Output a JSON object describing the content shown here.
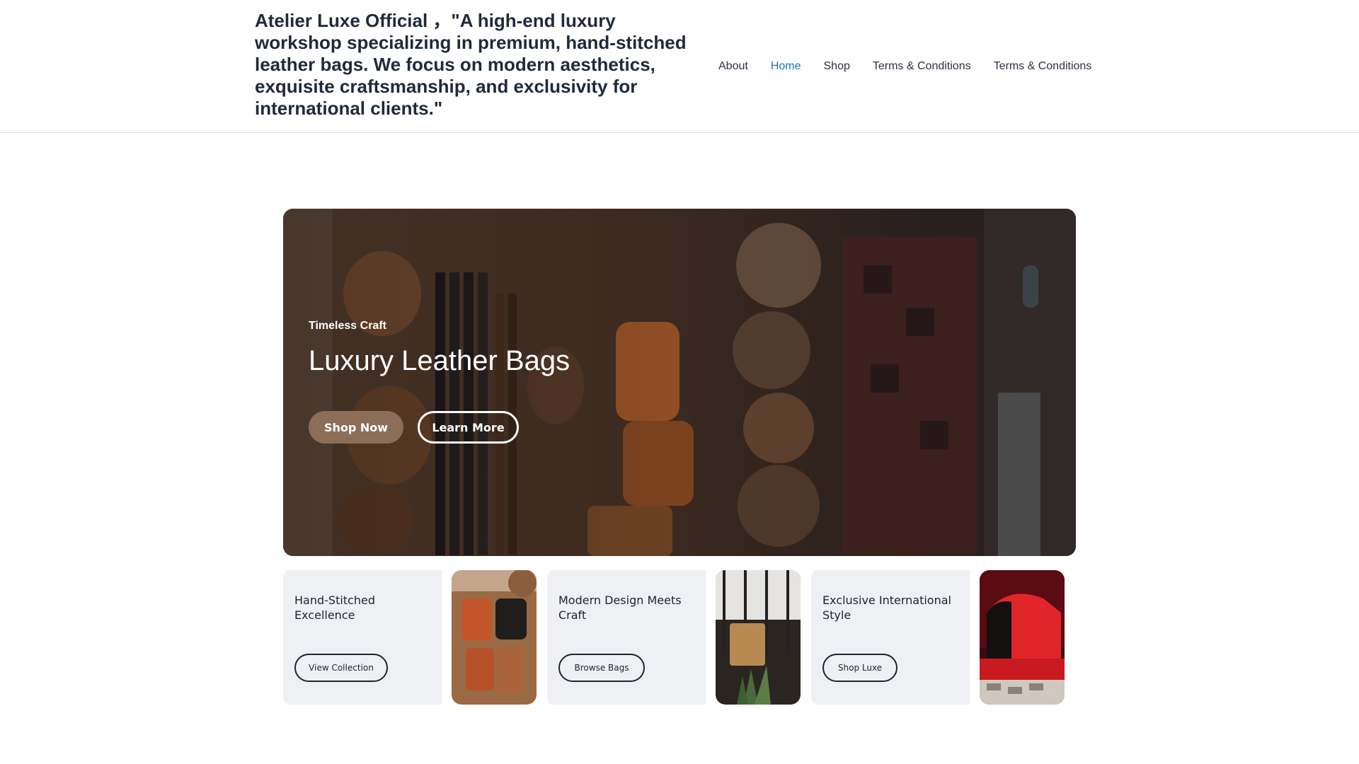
{
  "header": {
    "brand": "Atelier Luxe Official ，\"A high-end luxury workshop specializing in premium, hand-stitched leather bags. We focus on modern aesthetics, exquisite craftsmanship, and exclusivity for international clients.\"",
    "nav": [
      {
        "label": "About",
        "active": false
      },
      {
        "label": "Home",
        "active": true
      },
      {
        "label": "Shop",
        "active": false
      },
      {
        "label": "Terms & Conditions",
        "active": false
      },
      {
        "label": "Terms & Conditions",
        "active": false
      }
    ]
  },
  "hero": {
    "eyebrow": "Timeless Craft",
    "title": "Luxury Leather Bags",
    "primary_button": "Shop Now",
    "secondary_button": "Learn More"
  },
  "features": [
    {
      "title": "Hand-Stitched Excellence",
      "button": "View Collection"
    },
    {
      "title": "Modern Design Meets Craft",
      "button": "Browse Bags"
    },
    {
      "title": "Exclusive International Style",
      "button": "Shop Luxe"
    }
  ],
  "colors": {
    "accent": "#8c6e58",
    "nav_active": "#1f6fb5",
    "card_bg": "#eef0f3",
    "text": "#1f2a3a"
  }
}
